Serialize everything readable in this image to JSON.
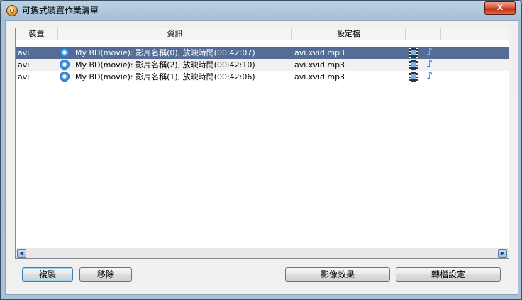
{
  "window": {
    "title": "可攜式裝置作業清單",
    "close_label": "x"
  },
  "columns": [
    "裝置",
    "資訊",
    "設定檔",
    "",
    ""
  ],
  "rows": [
    {
      "device": "avi",
      "info": "My BD(movie): 影片名稱(0), 放映時間(00:42:07)",
      "profile": "avi.xvid.mp3",
      "selected": true
    },
    {
      "device": "avi",
      "info": "My BD(movie): 影片名稱(2), 放映時間(00:42:10)",
      "profile": "avi.xvid.mp3",
      "selected": false
    },
    {
      "device": "avi",
      "info": "My BD(movie): 影片名稱(1), 放映時間(00:42:06)",
      "profile": "avi.xvid.mp3",
      "selected": false
    }
  ],
  "icons": {
    "row_media": "disc-icon",
    "video": "film-icon",
    "audio": "music-note-icon",
    "app": "app-icon"
  },
  "buttons": {
    "copy": "複製",
    "remove": "移除",
    "video_effect": "影像效果",
    "convert_settings": "轉檔設定"
  }
}
